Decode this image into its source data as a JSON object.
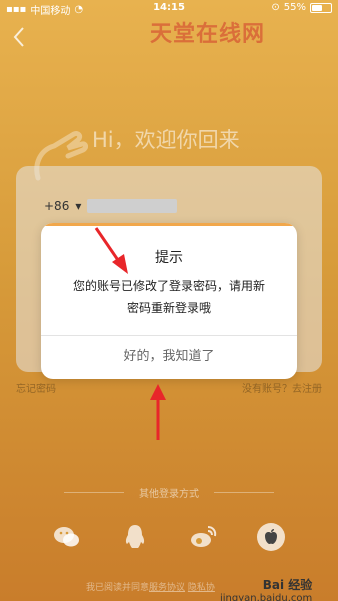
{
  "status": {
    "carrier": "中国移动",
    "time": "14:15",
    "battery": "55%",
    "battery_level": 0.55
  },
  "watermark_top": "天堂在线网",
  "welcome": "Hi，欢迎你回来",
  "form": {
    "country_code": "+86",
    "forgot": "忘记密码",
    "register": "没有账号？去注册"
  },
  "dialog": {
    "title": "提示",
    "line1": "您的账号已修改了登录密码，请用新",
    "line2": "密码重新登录哦",
    "confirm": "好的，我知道了"
  },
  "other_login": {
    "label": "其他登录方式",
    "icons": [
      "wechat-icon",
      "qq-icon",
      "weibo-icon",
      "apple-icon"
    ]
  },
  "agreement": {
    "text": "我已阅读并同意",
    "link1": "服务协议",
    "link2": "隐私协"
  },
  "watermark_bottom": {
    "brand": "Bai 经验",
    "url": "jingyan.baidu.com"
  },
  "colors": {
    "accent": "#f1a74b",
    "arrow": "#e8262a"
  }
}
